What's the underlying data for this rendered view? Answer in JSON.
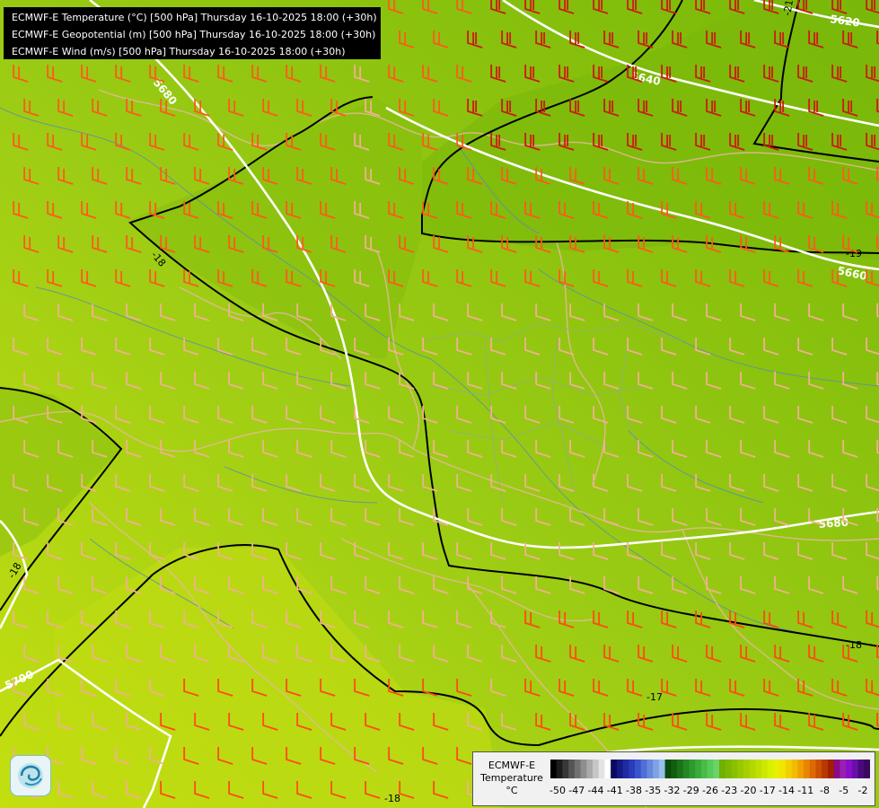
{
  "info": {
    "lines": [
      "ECMWF-E Temperature (°C) [500 hPa] Thursday 16-10-2025 18:00 (+30h)",
      "ECMWF-E Geopotential (m) [500 hPa] Thursday 16-10-2025 18:00 (+30h)",
      "ECMWF-E Wind (m/s) [500 hPa] Thursday 16-10-2025 18:00 (+30h)"
    ]
  },
  "map": {
    "geopotential_labels": [
      "5620",
      "5640",
      "5660",
      "5680",
      "5680",
      "5700"
    ],
    "isotherm_labels": [
      "-18",
      "-19",
      "-18",
      "-18",
      "-17",
      "-18",
      "-21"
    ]
  },
  "legend": {
    "title_lines": [
      "ECMWF-E",
      "Temperature",
      "°C"
    ],
    "tick_labels": [
      "-50",
      "-47",
      "-44",
      "-41",
      "-38",
      "-35",
      "-32",
      "-29",
      "-26",
      "-23",
      "-20",
      "-17",
      "-14",
      "-11",
      "-8",
      "-5",
      "-2"
    ],
    "colors": [
      "#000000",
      "#1c1c1c",
      "#383838",
      "#555555",
      "#717171",
      "#8e8e8e",
      "#aaaaaa",
      "#c6c6c6",
      "#e3e3e3",
      "#ffffff",
      "#0a0a5e",
      "#141a84",
      "#1f2ba0",
      "#2a3cba",
      "#3a55cc",
      "#4f6ed6",
      "#6688dd",
      "#7fa2e4",
      "#99bdec",
      "#0a4a0a",
      "#115e11",
      "#1a731a",
      "#238723",
      "#2e9a2e",
      "#3aab3a",
      "#48bb48",
      "#58ca58",
      "#69d469",
      "#70b000",
      "#7cb800",
      "#8ac000",
      "#98c800",
      "#a5d000",
      "#b3d800",
      "#c0e000",
      "#cce800",
      "#d9f000",
      "#e6f000",
      "#f0e400",
      "#f2d000",
      "#f2bc00",
      "#f0a000",
      "#e88400",
      "#dc6a00",
      "#cc5000",
      "#b83800",
      "#a02000",
      "#8a0a8a",
      "#9a20b0",
      "#8a10c8",
      "#6a10a8",
      "#4a0a7a",
      "#3a065e"
    ]
  }
}
